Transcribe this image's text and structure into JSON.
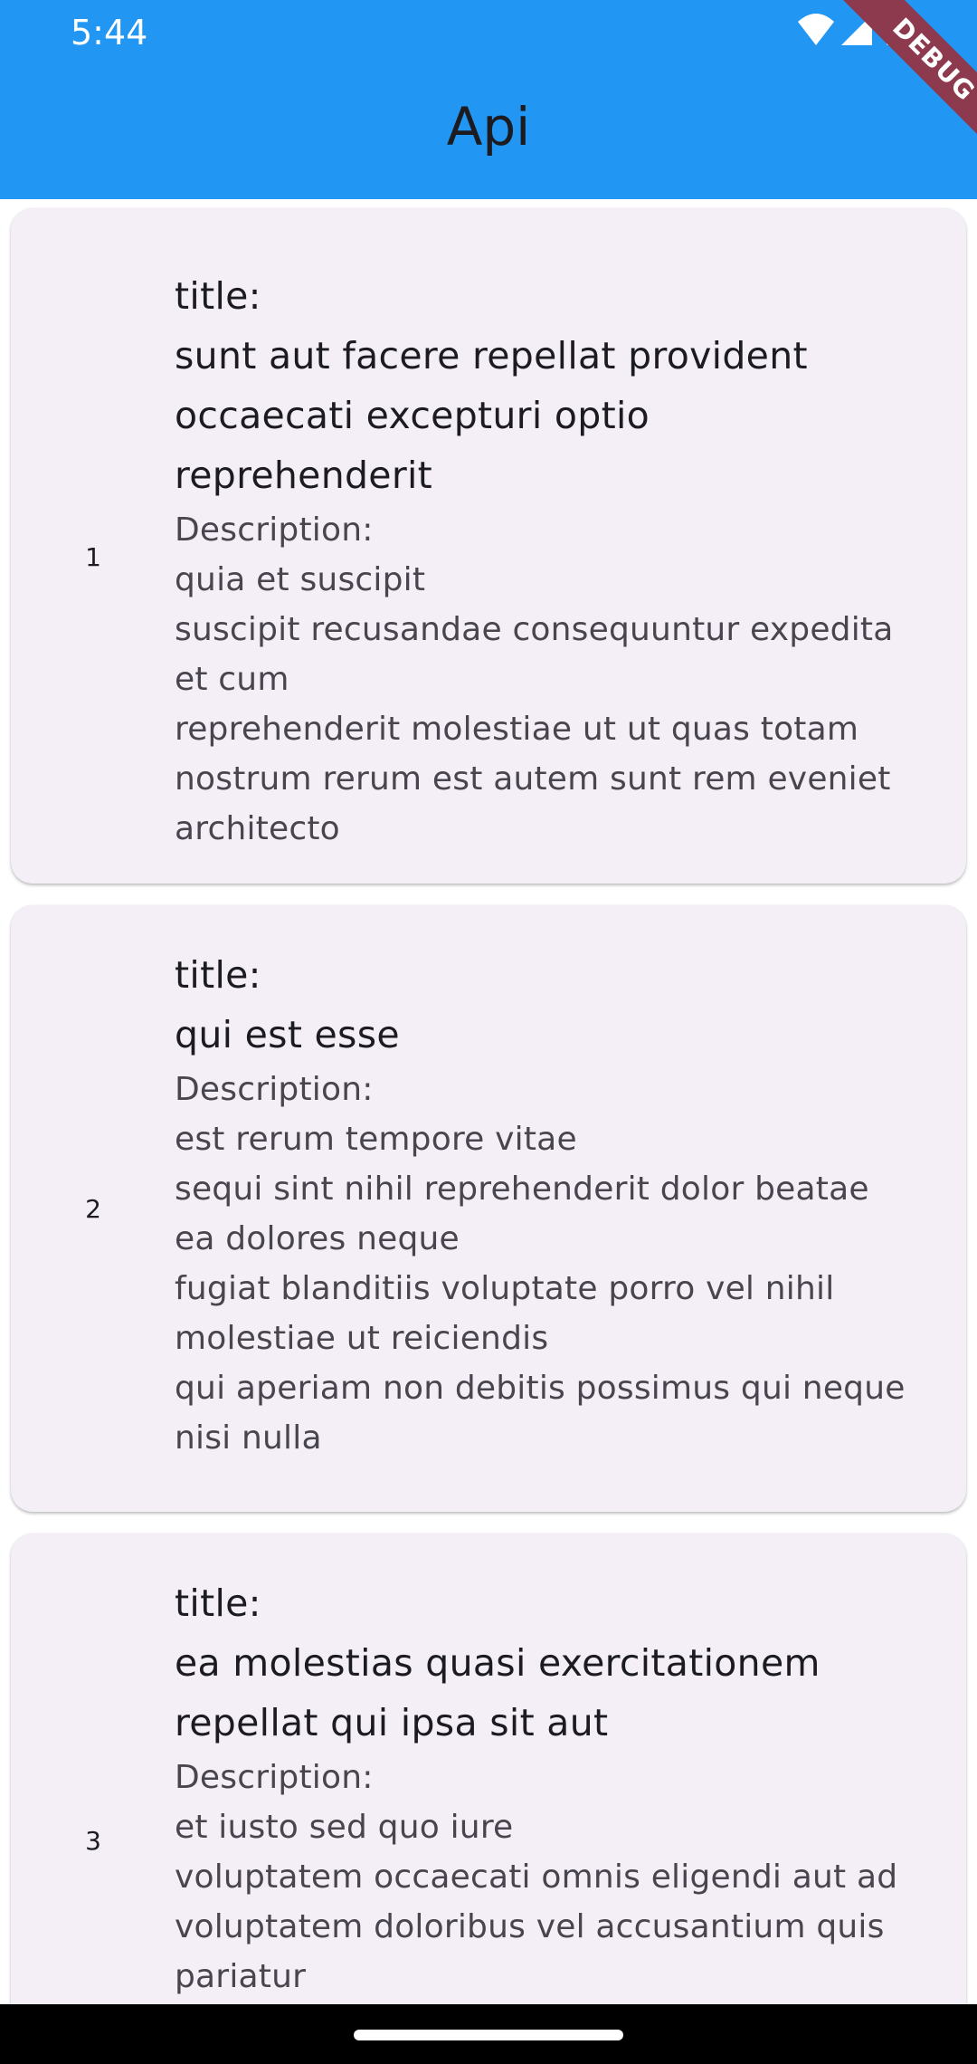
{
  "status_bar": {
    "time": "5:44"
  },
  "app_bar": {
    "title": "Api",
    "color": "#2196F3"
  },
  "debug_banner": {
    "label": "DEBUG"
  },
  "posts": [
    {
      "id": "1",
      "title_label": "title:",
      "title": "sunt aut facere repellat provident occaecati excepturi optio reprehenderit",
      "description_label": "Description:",
      "body": "quia et suscipit\nsuscipit recusandae consequuntur expedita et cum\nreprehenderit molestiae ut ut quas totam\nnostrum rerum est autem sunt rem eveniet architecto"
    },
    {
      "id": "2",
      "title_label": "title:",
      "title": "qui est esse",
      "description_label": "Description:",
      "body": "est rerum tempore vitae\nsequi sint nihil reprehenderit dolor beatae ea dolores neque\nfugiat blanditiis voluptate porro vel nihil molestiae ut reiciendis\nqui aperiam non debitis possimus qui neque nisi nulla"
    },
    {
      "id": "3",
      "title_label": "title:",
      "title": "ea molestias quasi exercitationem repellat qui ipsa sit aut",
      "description_label": "Description:",
      "body": "et iusto sed quo iure\nvoluptatem occaecati omnis eligendi aut ad\nvoluptatem doloribus vel accusantium quis pariatur"
    }
  ],
  "icons": {
    "wifi": "wifi-icon",
    "signal": "cellular-signal-icon",
    "battery": "battery-icon"
  }
}
